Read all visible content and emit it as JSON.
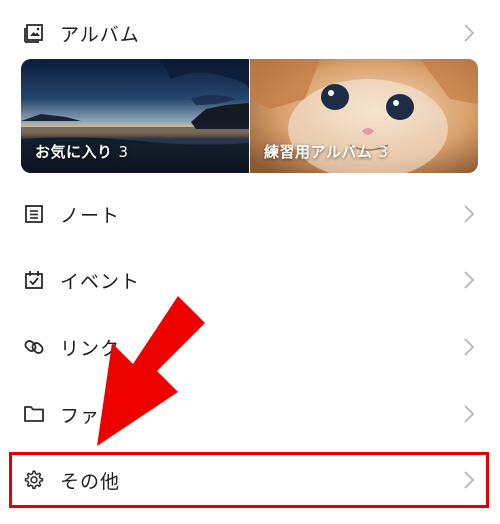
{
  "menu": {
    "album": {
      "label": "アルバム",
      "icon": "album-icon"
    },
    "note": {
      "label": "ノート",
      "icon": "note-icon"
    },
    "event": {
      "label": "イベント",
      "icon": "calendar-icon"
    },
    "link": {
      "label": "リンク",
      "icon": "link-icon"
    },
    "file": {
      "label": "ファ",
      "icon": "folder-icon"
    },
    "other": {
      "label": "その他",
      "icon": "gear-icon"
    }
  },
  "albums": [
    {
      "title": "お気に入り",
      "count": "3"
    },
    {
      "title": "練習用アルバム",
      "count": "3"
    }
  ],
  "colors": {
    "highlight": "#e40000",
    "arrow": "#ee0000",
    "chevron": "#b5b5b5",
    "text": "#1e1e1e"
  }
}
